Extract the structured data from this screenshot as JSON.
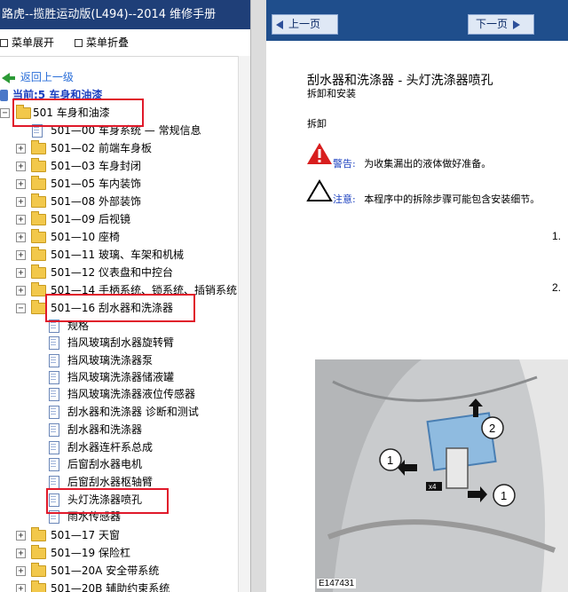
{
  "left_panel": {
    "title": "路虎--揽胜运动版(L494)--2014 维修手册",
    "toolbar": {
      "expand_label": "菜单展开",
      "collapse_label": "菜单折叠"
    },
    "back_label": "返回上一级",
    "current_label": "当前:5 车身和油漆",
    "tree": [
      {
        "label": "501 车身和油漆"
      },
      {
        "label": "501—00 车身系统 — 常规信息"
      },
      {
        "label": "501—02 前端车身板"
      },
      {
        "label": "501—03 车身封闭"
      },
      {
        "label": "501—05 车内装饰"
      },
      {
        "label": "501—08 外部装饰"
      },
      {
        "label": "501—09 后视镜"
      },
      {
        "label": "501—10 座椅"
      },
      {
        "label": "501—11 玻璃、车架和机械"
      },
      {
        "label": "501—12 仪表盘和中控台"
      },
      {
        "label": "501—14 手柄系统、锁系统、插销系统"
      },
      {
        "label": "501—16 刮水器和洗涤器"
      },
      {
        "label": "规格"
      },
      {
        "label": "挡风玻璃刮水器旋转臂"
      },
      {
        "label": "挡风玻璃洗涤器泵"
      },
      {
        "label": "挡风玻璃洗涤器储液罐"
      },
      {
        "label": "挡风玻璃洗涤器液位传感器"
      },
      {
        "label": "刮水器和洗涤器 诊断和测试"
      },
      {
        "label": "刮水器和洗涤器"
      },
      {
        "label": "刮水器连杆系总成"
      },
      {
        "label": "后窗刮水器电机"
      },
      {
        "label": "后窗刮水器枢轴臂"
      },
      {
        "label": "头灯洗涤器喷孔"
      },
      {
        "label": "雨水传感器"
      },
      {
        "label": "501—17 天窗"
      },
      {
        "label": "501—19 保险杠"
      },
      {
        "label": "501—20A 安全带系统"
      },
      {
        "label": "501—20B 辅助约束系统"
      }
    ]
  },
  "right_panel": {
    "prev_label": "上一页",
    "next_label": "下一页",
    "doc_title": "刮水器和洗涤器 - 头灯洗涤器喷孔",
    "doc_subtitle": "拆卸和安装",
    "section_label": "拆卸",
    "warning_label": "警告:",
    "warning_text": "为收集漏出的液体做好准备。",
    "note_label": "注意:",
    "note_text": "本程序中的拆除步骤可能包含安装细节。",
    "steps": [
      "1.",
      "2."
    ],
    "figure": {
      "callouts": [
        "1",
        "2",
        "1"
      ],
      "tag": "x4",
      "caption": "E147431"
    }
  },
  "colors": {
    "title_bar": "#1f3f78",
    "nav_bar": "#1f4e8c",
    "highlight": "#e0192a",
    "link": "#2a6ed8",
    "warning": "#d81e1e"
  }
}
